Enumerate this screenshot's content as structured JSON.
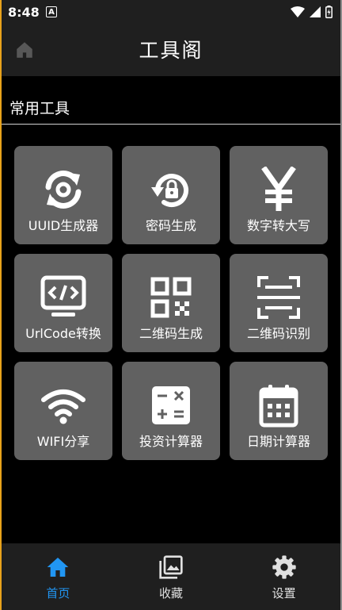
{
  "status_bar": {
    "time": "8:48",
    "notification_icon": "A"
  },
  "app_bar": {
    "title": "工具阁",
    "left_icon": "home-icon"
  },
  "section": {
    "label": "常用工具"
  },
  "tools": [
    {
      "label": "UUID生成器",
      "icon": "refresh-icon"
    },
    {
      "label": "密码生成",
      "icon": "lock-reset-icon"
    },
    {
      "label": "数字转大写",
      "icon": "yen-icon"
    },
    {
      "label": "UrlCode转换",
      "icon": "code-monitor-icon"
    },
    {
      "label": "二维码生成",
      "icon": "qrcode-icon"
    },
    {
      "label": "二维码识别",
      "icon": "scan-icon"
    },
    {
      "label": "WIFI分享",
      "icon": "wifi-icon"
    },
    {
      "label": "投资计算器",
      "icon": "calculator-icon"
    },
    {
      "label": "日期计算器",
      "icon": "calendar-icon"
    }
  ],
  "bottom_nav": [
    {
      "label": "首页",
      "icon": "home-icon",
      "active": true
    },
    {
      "label": "收藏",
      "icon": "image-icon",
      "active": false
    },
    {
      "label": "设置",
      "icon": "gear-icon",
      "active": false
    }
  ],
  "colors": {
    "accent": "#2196f3",
    "tile": "#616161",
    "bar": "#1f1f1f",
    "background": "#000000"
  }
}
